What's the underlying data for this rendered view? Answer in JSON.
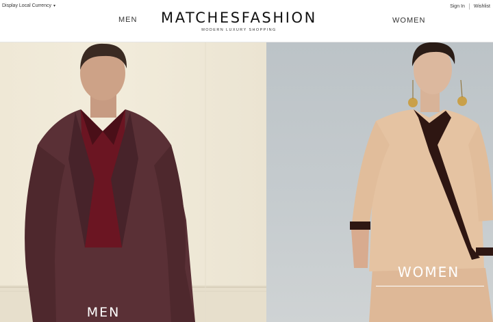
{
  "header": {
    "currency_label": "Display Local Currency",
    "currency_caret": "▾",
    "sign_in": "Sign In",
    "wishlist": "Wishlist",
    "nav_men": "MEN",
    "nav_women": "WOMEN",
    "logo": "MATCHESFASHION",
    "tagline": "MODERN LUXURY SHOPPING"
  },
  "hero": {
    "men_label": "MEN",
    "women_label": "WOMEN"
  }
}
